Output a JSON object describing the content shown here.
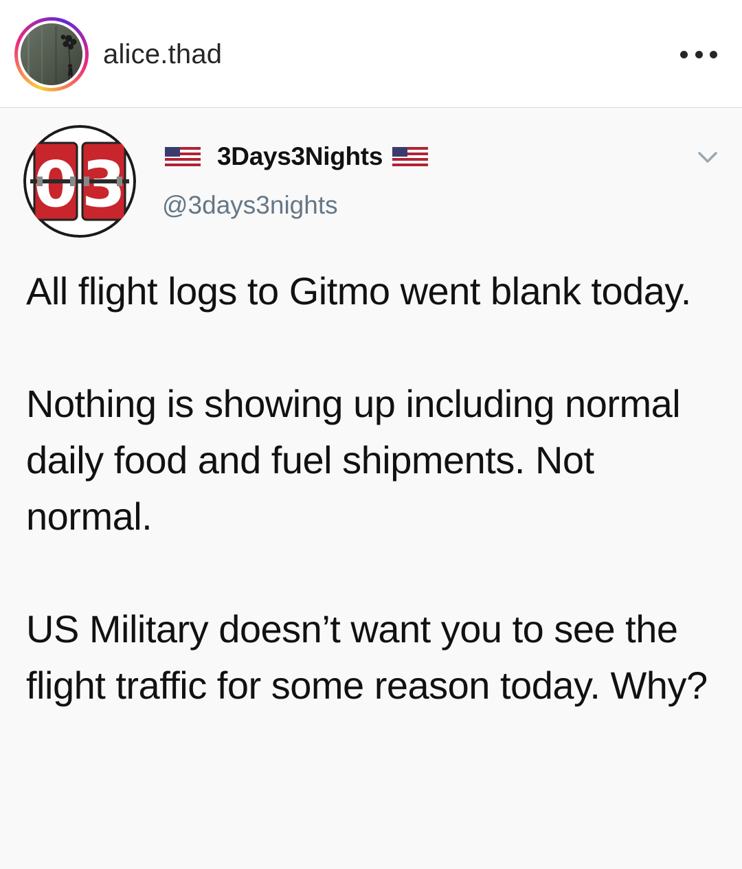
{
  "instagram": {
    "username": "alice.thad",
    "avatar_icon": "banksy-balloon-girl-avatar",
    "more_icon": "more-options-icon"
  },
  "tweet": {
    "display_name": "3Days3Nights",
    "handle": "@3days3nights",
    "avatar_text": "03",
    "name_prefix_icon": "us-flag-icon",
    "name_suffix_icon": "us-flag-icon",
    "caret_icon": "chevron-down-icon",
    "paragraphs": [
      "All flight logs to Gitmo went blank today.",
      "Nothing is showing up including normal daily food and fuel shipments. Not normal.",
      "US Military doesn’t want you to see the flight traffic for some reason today. Why?"
    ]
  },
  "colors": {
    "handle_gray": "#657786",
    "tweet_bg": "#f9f9f9",
    "avatar_red": "#c9252c"
  }
}
